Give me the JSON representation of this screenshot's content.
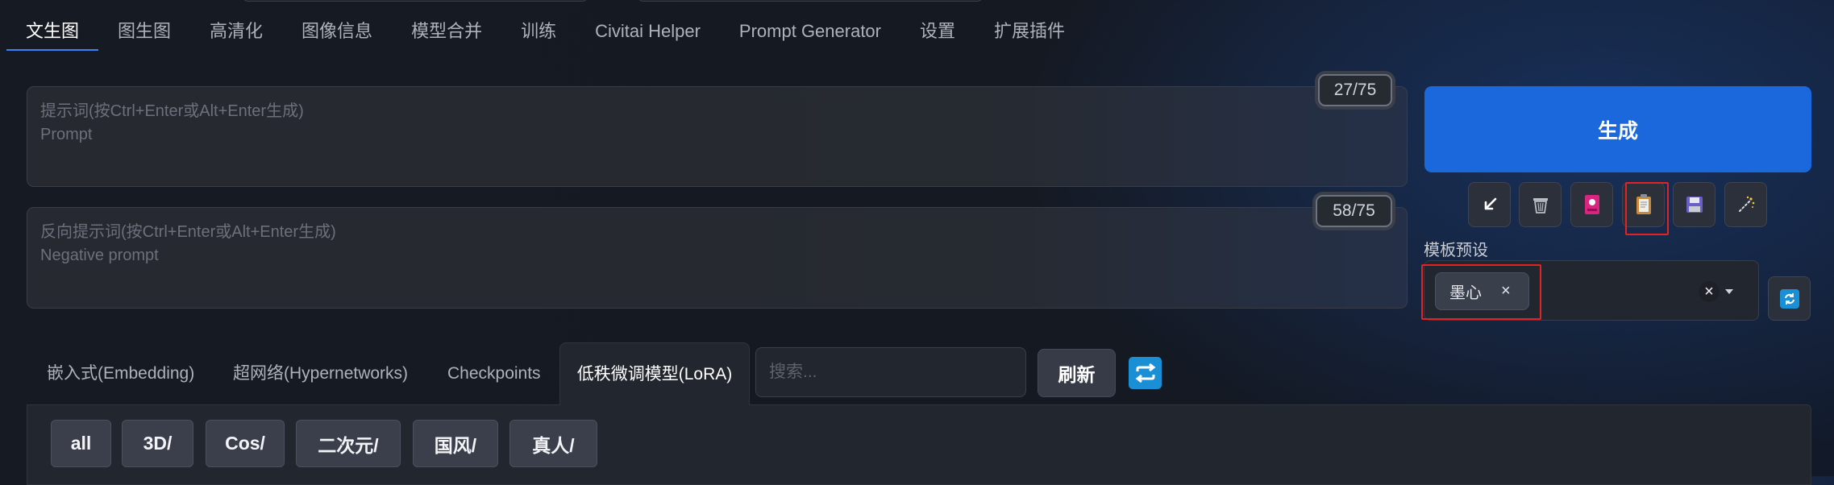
{
  "tabs": [
    {
      "label": "文生图",
      "active": true
    },
    {
      "label": "图生图"
    },
    {
      "label": "高清化"
    },
    {
      "label": "图像信息"
    },
    {
      "label": "模型合并"
    },
    {
      "label": "训练"
    },
    {
      "label": "Civitai Helper"
    },
    {
      "label": "Prompt Generator"
    },
    {
      "label": "设置"
    },
    {
      "label": "扩展插件"
    }
  ],
  "prompt": {
    "placeholder_cn": "提示词(按Ctrl+Enter或Alt+Enter生成)",
    "placeholder_en": "Prompt",
    "counter": "27/75"
  },
  "negative_prompt": {
    "placeholder_cn": "反向提示词(按Ctrl+Enter或Alt+Enter生成)",
    "placeholder_en": "Negative prompt",
    "counter": "58/75"
  },
  "generate_label": "生成",
  "toolbar": {
    "icons": [
      "arrow-down-left-icon",
      "trash-icon",
      "image-card-icon",
      "clipboard-icon",
      "save-icon",
      "magic-sparkle-icon"
    ]
  },
  "preset": {
    "label": "模板预设",
    "selected_chip": "墨心",
    "chip_remove": "×",
    "clear": "×"
  },
  "extra_tabs": [
    {
      "label": "嵌入式(Embedding)"
    },
    {
      "label": "超网络(Hypernetworks)"
    },
    {
      "label": "Checkpoints"
    },
    {
      "label": "低秩微调模型(LoRA)",
      "active": true
    }
  ],
  "search": {
    "placeholder": "搜索..."
  },
  "refresh_label": "刷新",
  "filters": [
    "all",
    "3D/",
    "Cos/",
    "二次元/",
    "国风/",
    "真人/"
  ],
  "colors": {
    "accent": "#1a68dc",
    "highlight": "#e02424",
    "sync": "#1b8fd6"
  }
}
